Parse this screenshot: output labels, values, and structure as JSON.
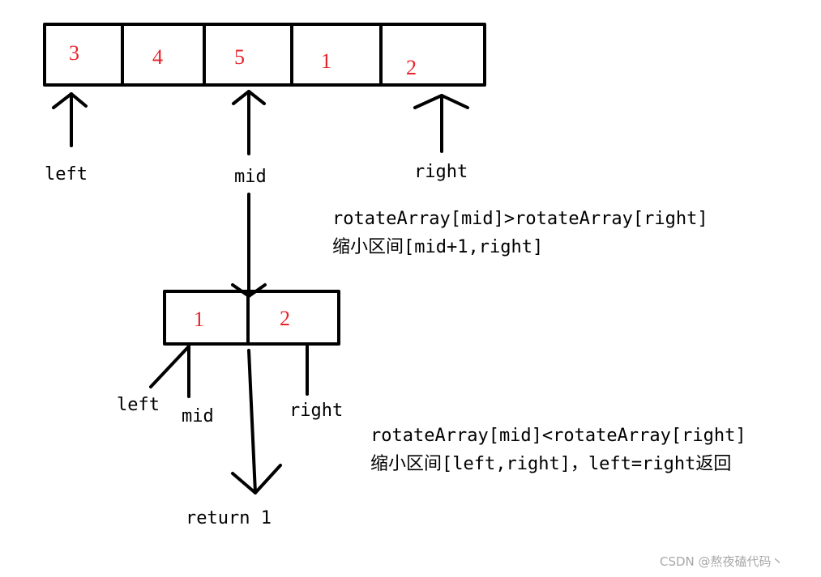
{
  "top_array": {
    "cells": [
      "3",
      "4",
      "5",
      "1",
      "2"
    ],
    "pointers": {
      "left": "left",
      "mid": "mid",
      "right": "right"
    }
  },
  "step1": {
    "condition": "rotateArray[mid]>rotateArray[right]",
    "action": "缩小区间[mid+1,right]"
  },
  "bottom_array": {
    "cells": [
      "1",
      "2"
    ],
    "pointers": {
      "left": "left",
      "mid": "mid",
      "right": "right"
    }
  },
  "step2": {
    "condition": "rotateArray[mid]<rotateArray[right]",
    "action": "缩小区间[left,right]，left=right返回"
  },
  "result": "return 1",
  "watermark": "CSDN @熬夜磕代码丶",
  "colors": {
    "cell_value": "#e8242b",
    "line": "#000000",
    "watermark": "#a8a8a8"
  }
}
